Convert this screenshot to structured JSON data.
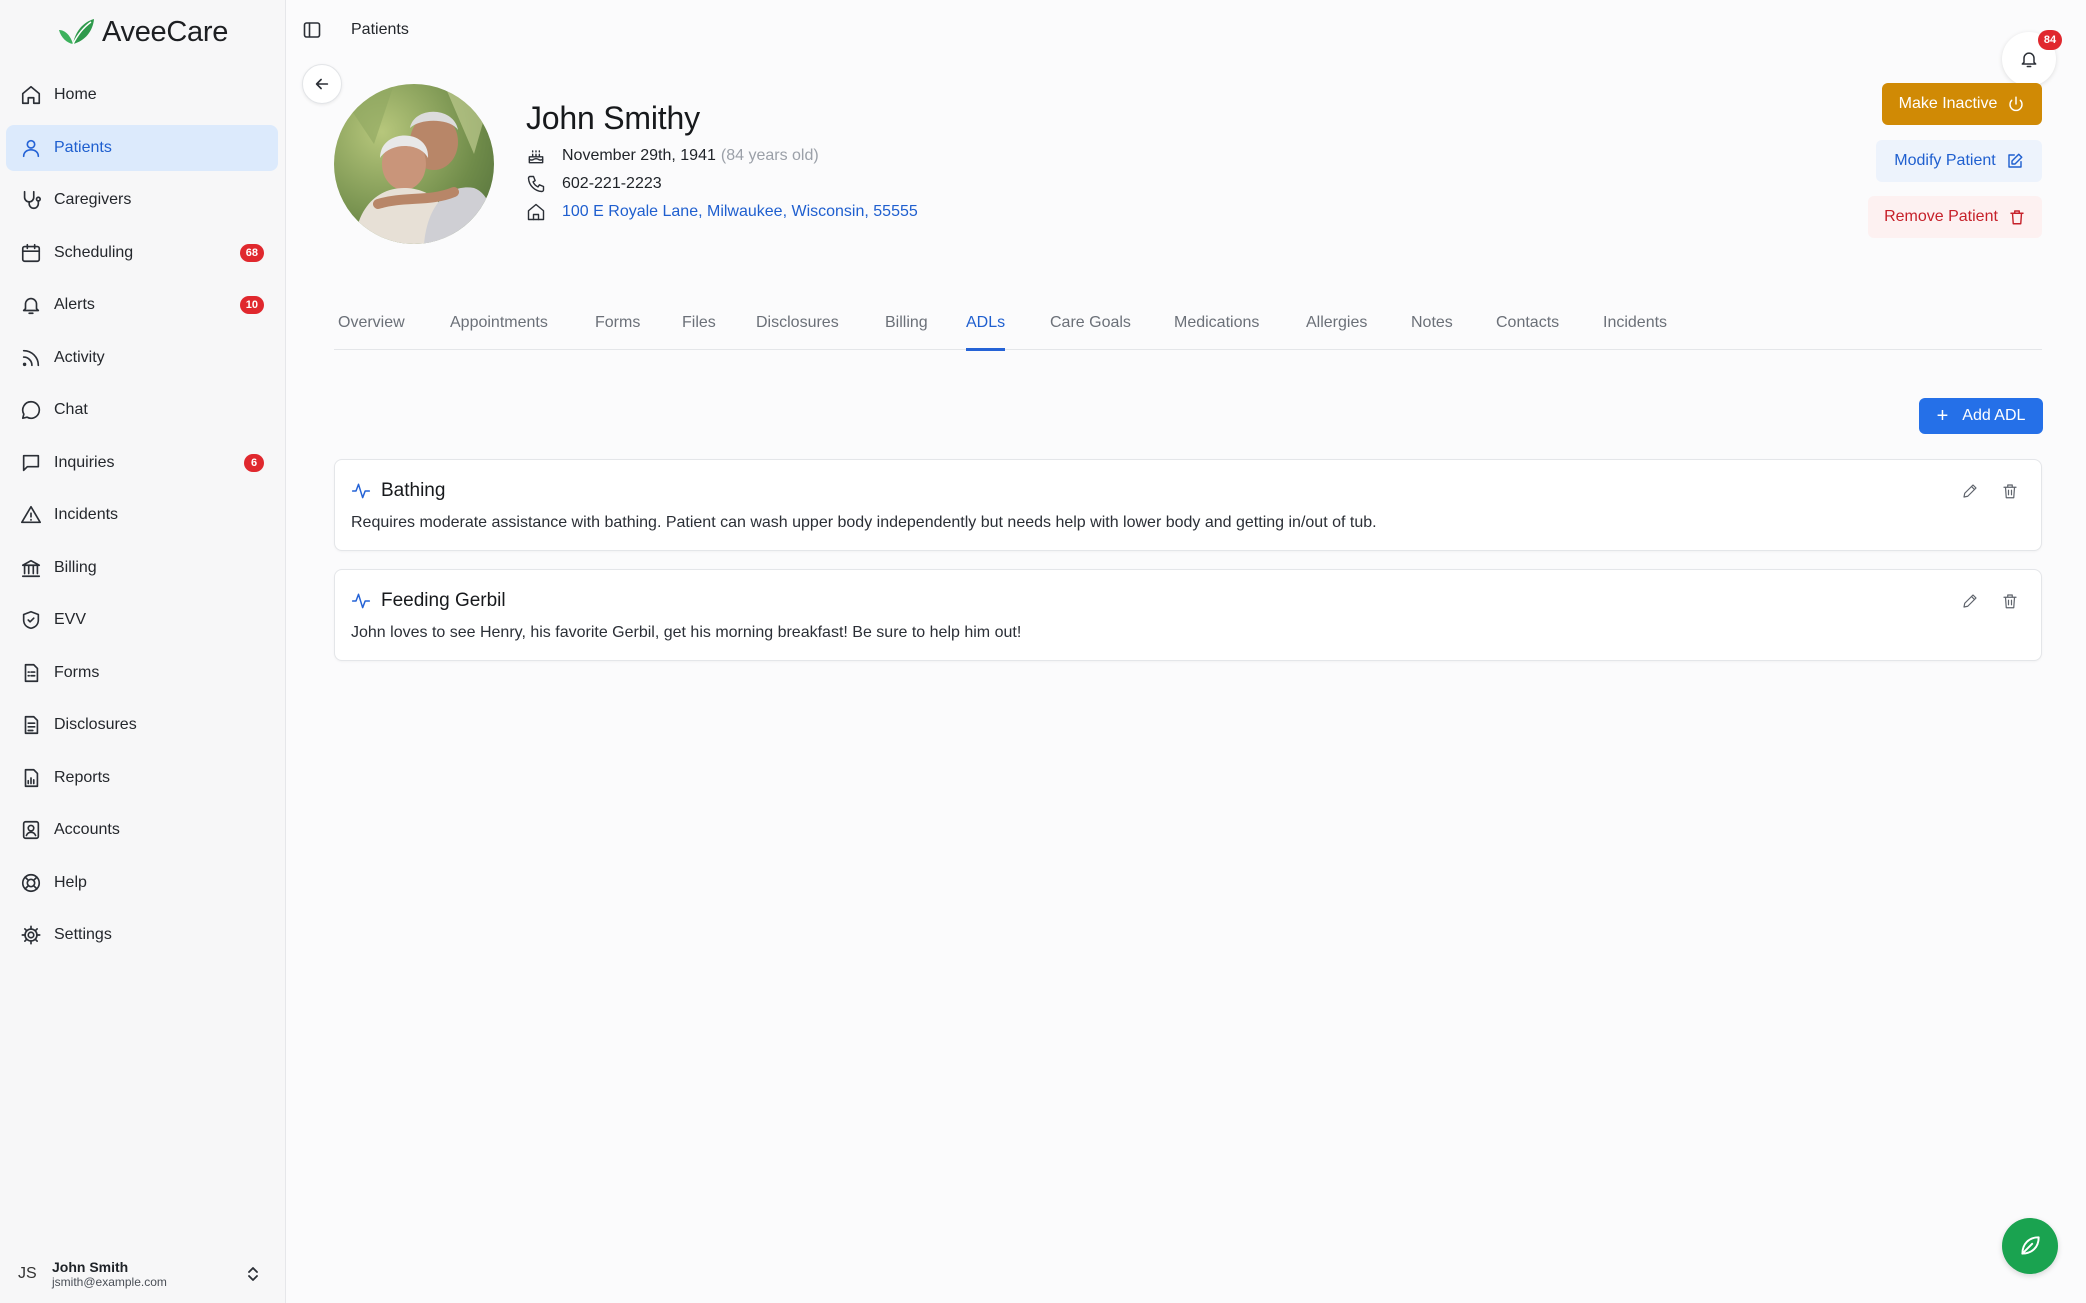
{
  "app": {
    "brand": "AveeCare",
    "brand_color": "#2fb35a",
    "accent": "#2563d6"
  },
  "sidebar": {
    "items": [
      {
        "label": "Home",
        "icon": "home-icon",
        "active": false,
        "badge": null
      },
      {
        "label": "Patients",
        "icon": "user-icon",
        "active": true,
        "badge": null
      },
      {
        "label": "Caregivers",
        "icon": "stethoscope-icon",
        "active": false,
        "badge": null
      },
      {
        "label": "Scheduling",
        "icon": "calendar-icon",
        "active": false,
        "badge": "68"
      },
      {
        "label": "Alerts",
        "icon": "bell-icon",
        "active": false,
        "badge": "10"
      },
      {
        "label": "Activity",
        "icon": "rss-icon",
        "active": false,
        "badge": null
      },
      {
        "label": "Chat",
        "icon": "chat-bubble-icon",
        "active": false,
        "badge": null
      },
      {
        "label": "Inquiries",
        "icon": "message-square-icon",
        "active": false,
        "badge": "6"
      },
      {
        "label": "Incidents",
        "icon": "warning-triangle-icon",
        "active": false,
        "badge": null
      },
      {
        "label": "Billing",
        "icon": "bank-icon",
        "active": false,
        "badge": null
      },
      {
        "label": "EVV",
        "icon": "shield-check-icon",
        "active": false,
        "badge": null
      },
      {
        "label": "Forms",
        "icon": "form-document-icon",
        "active": false,
        "badge": null
      },
      {
        "label": "Disclosures",
        "icon": "document-text-icon",
        "active": false,
        "badge": null
      },
      {
        "label": "Reports",
        "icon": "report-chart-icon",
        "active": false,
        "badge": null
      },
      {
        "label": "Accounts",
        "icon": "contact-card-icon",
        "active": false,
        "badge": null
      },
      {
        "label": "Help",
        "icon": "lifebuoy-icon",
        "active": false,
        "badge": null
      },
      {
        "label": "Settings",
        "icon": "gear-icon",
        "active": false,
        "badge": null
      }
    ],
    "user": {
      "initials": "JS",
      "name": "John Smith",
      "email": "jsmith@example.com"
    }
  },
  "header": {
    "breadcrumb": "Patients",
    "notification_count": "84"
  },
  "patient": {
    "name": "John Smithy",
    "dob": "November 29th, 1941",
    "age": "(84 years old)",
    "phone": "602-221-2223",
    "address": "100 E Royale Lane, Milwaukee, Wisconsin, 55555"
  },
  "actions": {
    "make_inactive": "Make Inactive",
    "modify": "Modify Patient",
    "remove": "Remove Patient"
  },
  "tabs": [
    {
      "label": "Overview",
      "active": false
    },
    {
      "label": "Appointments",
      "active": false
    },
    {
      "label": "Forms",
      "active": false
    },
    {
      "label": "Files",
      "active": false
    },
    {
      "label": "Disclosures",
      "active": false
    },
    {
      "label": "Billing",
      "active": false
    },
    {
      "label": "ADLs",
      "active": true
    },
    {
      "label": "Care Goals",
      "active": false
    },
    {
      "label": "Medications",
      "active": false
    },
    {
      "label": "Allergies",
      "active": false
    },
    {
      "label": "Notes",
      "active": false
    },
    {
      "label": "Contacts",
      "active": false
    },
    {
      "label": "Incidents",
      "active": false
    }
  ],
  "adls": {
    "add_label": "Add ADL",
    "items": [
      {
        "title": "Bathing",
        "description": "Requires moderate assistance with bathing. Patient can wash upper body independently but needs help with lower body and getting in/out of tub."
      },
      {
        "title": "Feeding Gerbil",
        "description": "John loves to see Henry, his favorite Gerbil, get his morning breakfast! Be sure to help him out!"
      }
    ]
  }
}
